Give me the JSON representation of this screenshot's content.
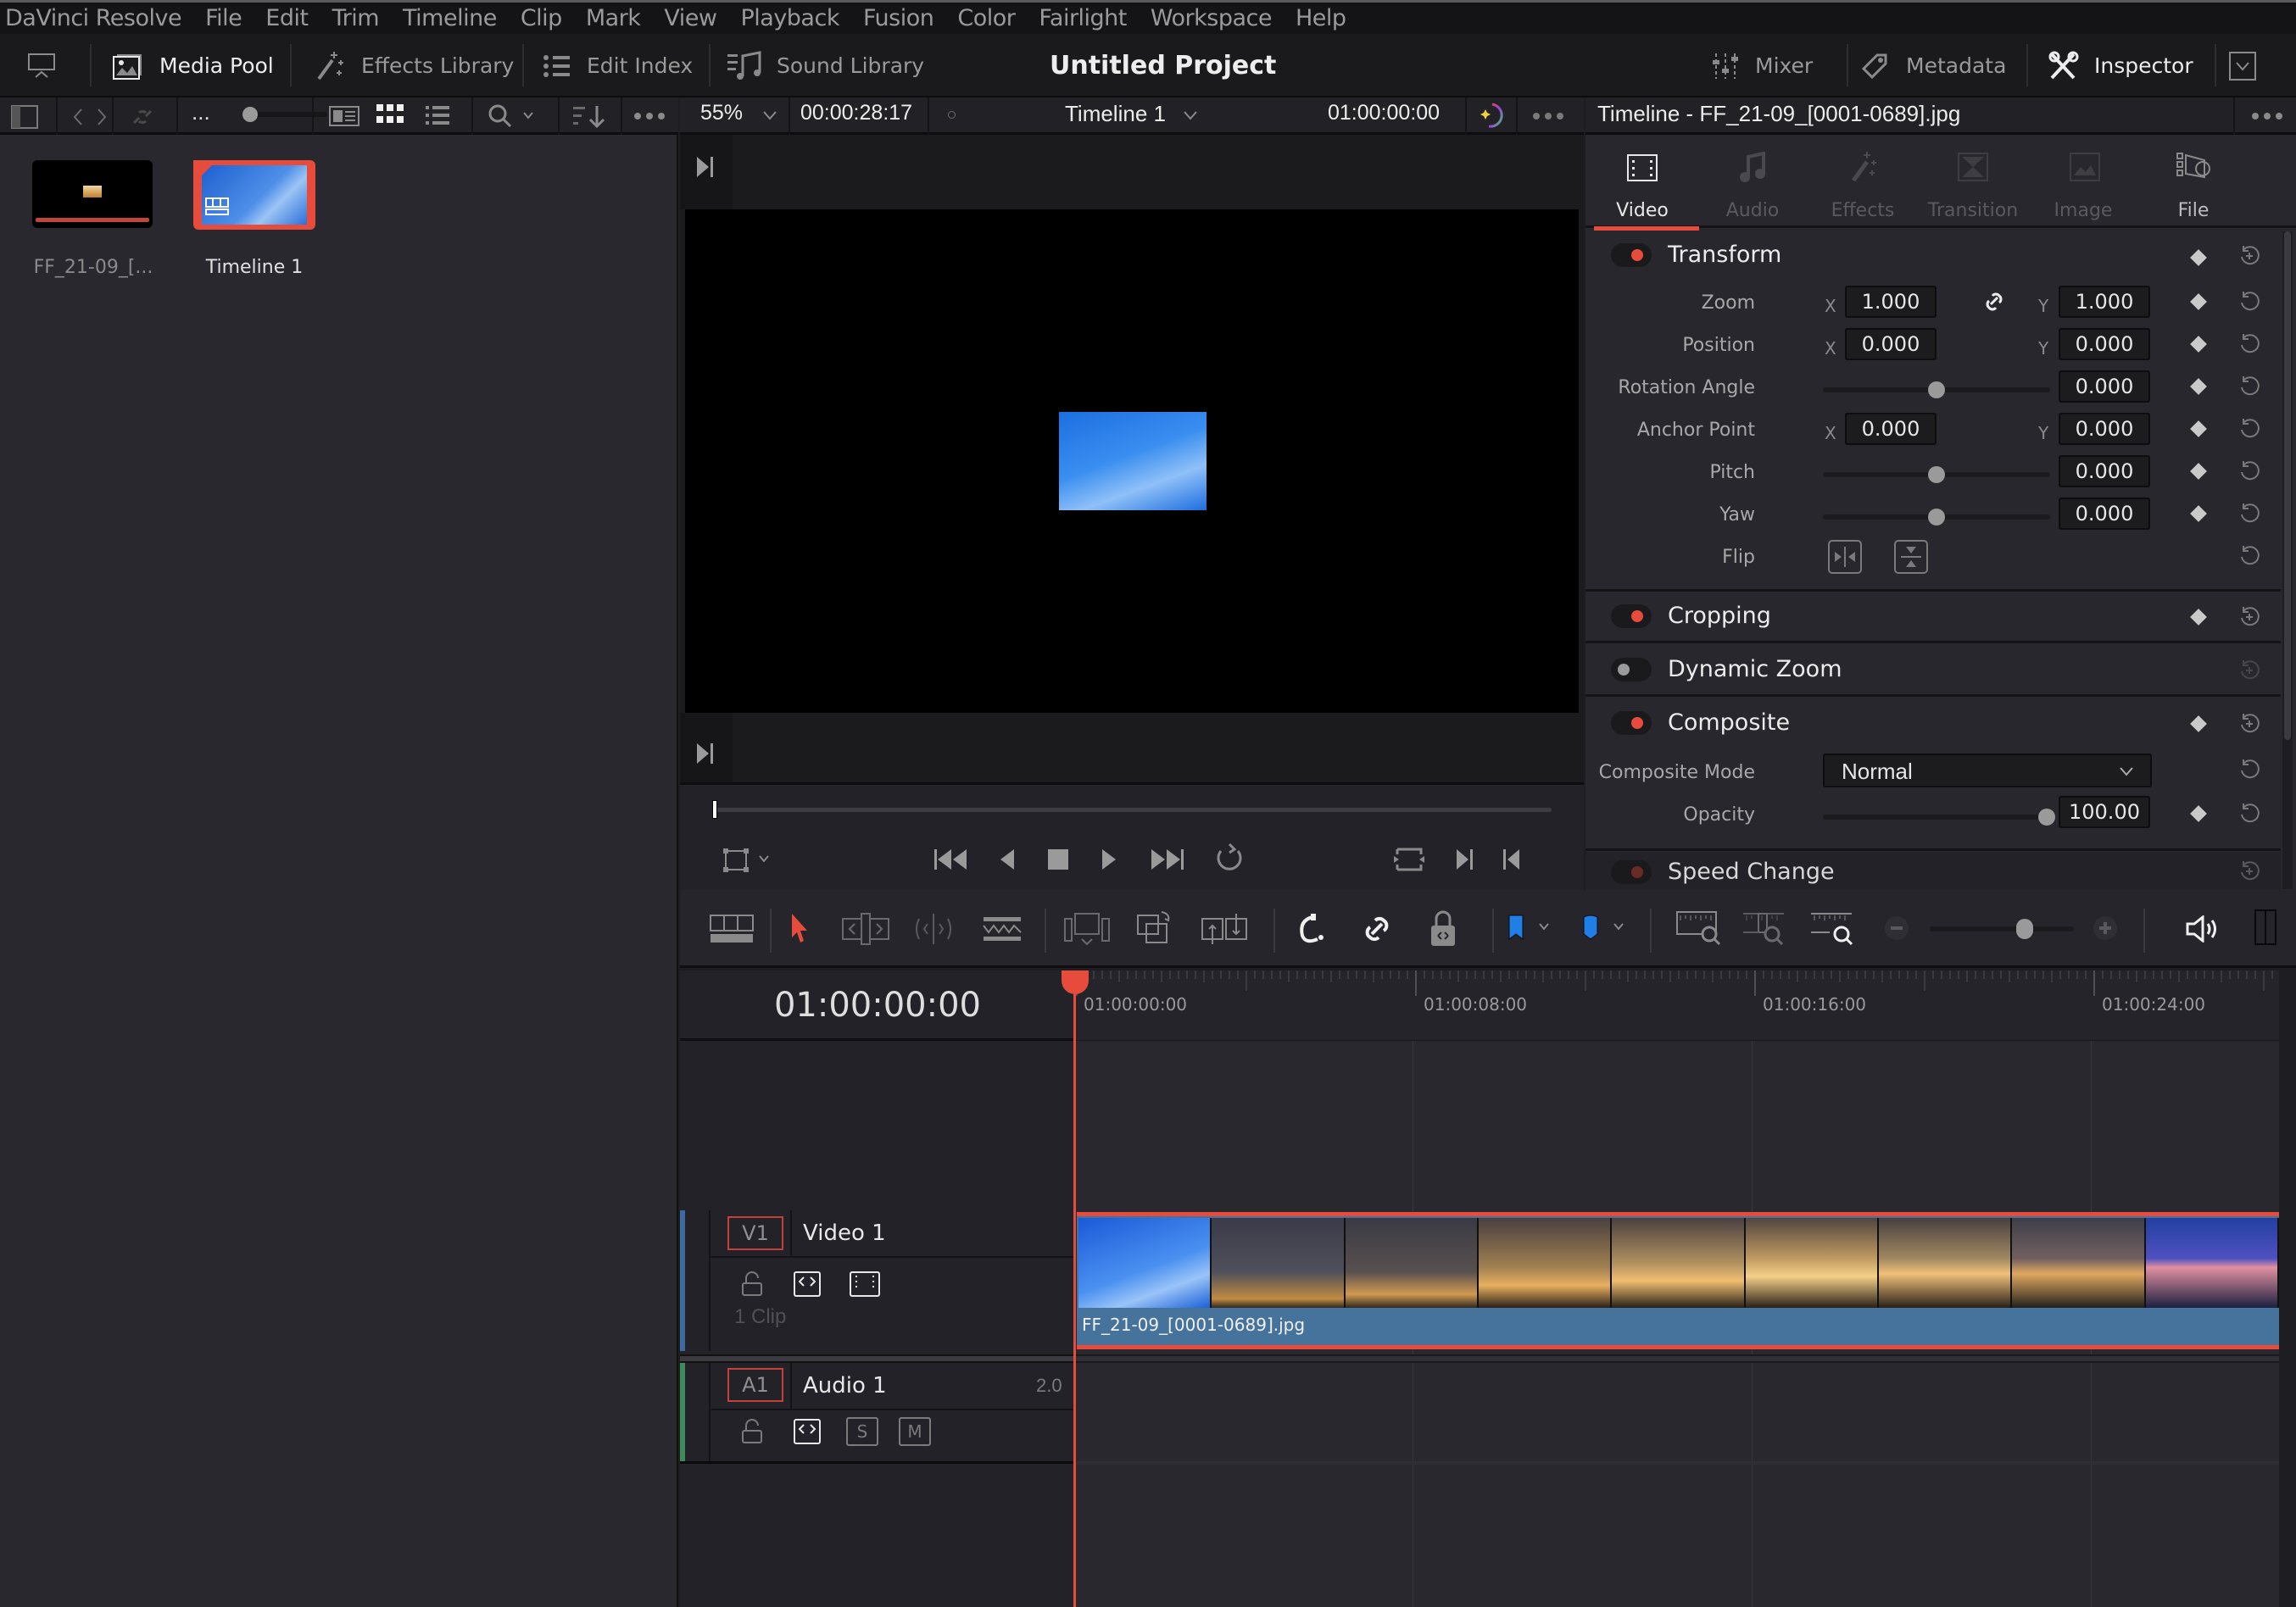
{
  "menubar": {
    "items": [
      "DaVinci Resolve",
      "File",
      "Edit",
      "Trim",
      "Timeline",
      "Clip",
      "Mark",
      "View",
      "Playback",
      "Fusion",
      "Color",
      "Fairlight",
      "Workspace",
      "Help"
    ]
  },
  "toolbar": {
    "media_pool": "Media Pool",
    "effects_library": "Effects Library",
    "edit_index": "Edit Index",
    "sound_library": "Sound Library",
    "project_title": "Untitled Project",
    "mixer": "Mixer",
    "metadata": "Metadata",
    "inspector": "Inspector"
  },
  "media_pool": {
    "overflow_label": "...",
    "clips": [
      {
        "name": "FF_21-09_[...",
        "type": "media"
      },
      {
        "name": "Timeline 1",
        "type": "timeline",
        "selected": true
      }
    ]
  },
  "viewer": {
    "zoom": "55%",
    "duration": "00:00:28:17",
    "timeline_name": "Timeline 1",
    "timecode": "01:00:00:00",
    "scrub_position": 0
  },
  "inspector": {
    "title": "Timeline - FF_21-09_[0001-0689].jpg",
    "tabs": [
      {
        "label": "Video",
        "active": true
      },
      {
        "label": "Audio",
        "active": false
      },
      {
        "label": "Effects",
        "active": false
      },
      {
        "label": "Transition",
        "active": false
      },
      {
        "label": "Image",
        "active": false
      },
      {
        "label": "File",
        "active": false
      }
    ],
    "transform": {
      "title": "Transform",
      "enabled": true,
      "zoom_label": "Zoom",
      "zoom_x": "1.000",
      "zoom_y": "1.000",
      "position_label": "Position",
      "position_x": "0.000",
      "position_y": "0.000",
      "rotation_label": "Rotation Angle",
      "rotation": "0.000",
      "anchor_label": "Anchor Point",
      "anchor_x": "0.000",
      "anchor_y": "0.000",
      "pitch_label": "Pitch",
      "pitch": "0.000",
      "yaw_label": "Yaw",
      "yaw": "0.000",
      "flip_label": "Flip",
      "x_axis": "X",
      "y_axis": "Y"
    },
    "cropping": {
      "title": "Cropping",
      "enabled": true
    },
    "dynamic_zoom": {
      "title": "Dynamic Zoom",
      "enabled": false
    },
    "composite": {
      "title": "Composite",
      "enabled": true,
      "mode_label": "Composite Mode",
      "mode_value": "Normal",
      "opacity_label": "Opacity",
      "opacity": "100.00"
    },
    "speed_change": {
      "title": "Speed Change"
    }
  },
  "timeline": {
    "timecode": "01:00:00:00",
    "ruler_labels": [
      "01:00:00:00",
      "01:00:08:00",
      "01:00:16:00",
      "01:00:24:00"
    ],
    "zoom_level": 0.68,
    "tracks": [
      {
        "tag": "V1",
        "name": "Video 1",
        "info": "1 Clip"
      },
      {
        "tag": "A1",
        "name": "Audio 1",
        "channels": "2.0",
        "solo": "S",
        "mute": "M"
      }
    ],
    "clip": {
      "name": "FF_21-09_[0001-0689].jpg"
    }
  },
  "colors": {
    "accent_red": "#e64b3c",
    "clip_blue": "#46739c",
    "marker_blue": "#1f7fe6",
    "video_track": "#3f6aa0",
    "audio_track": "#3f8a5a"
  }
}
